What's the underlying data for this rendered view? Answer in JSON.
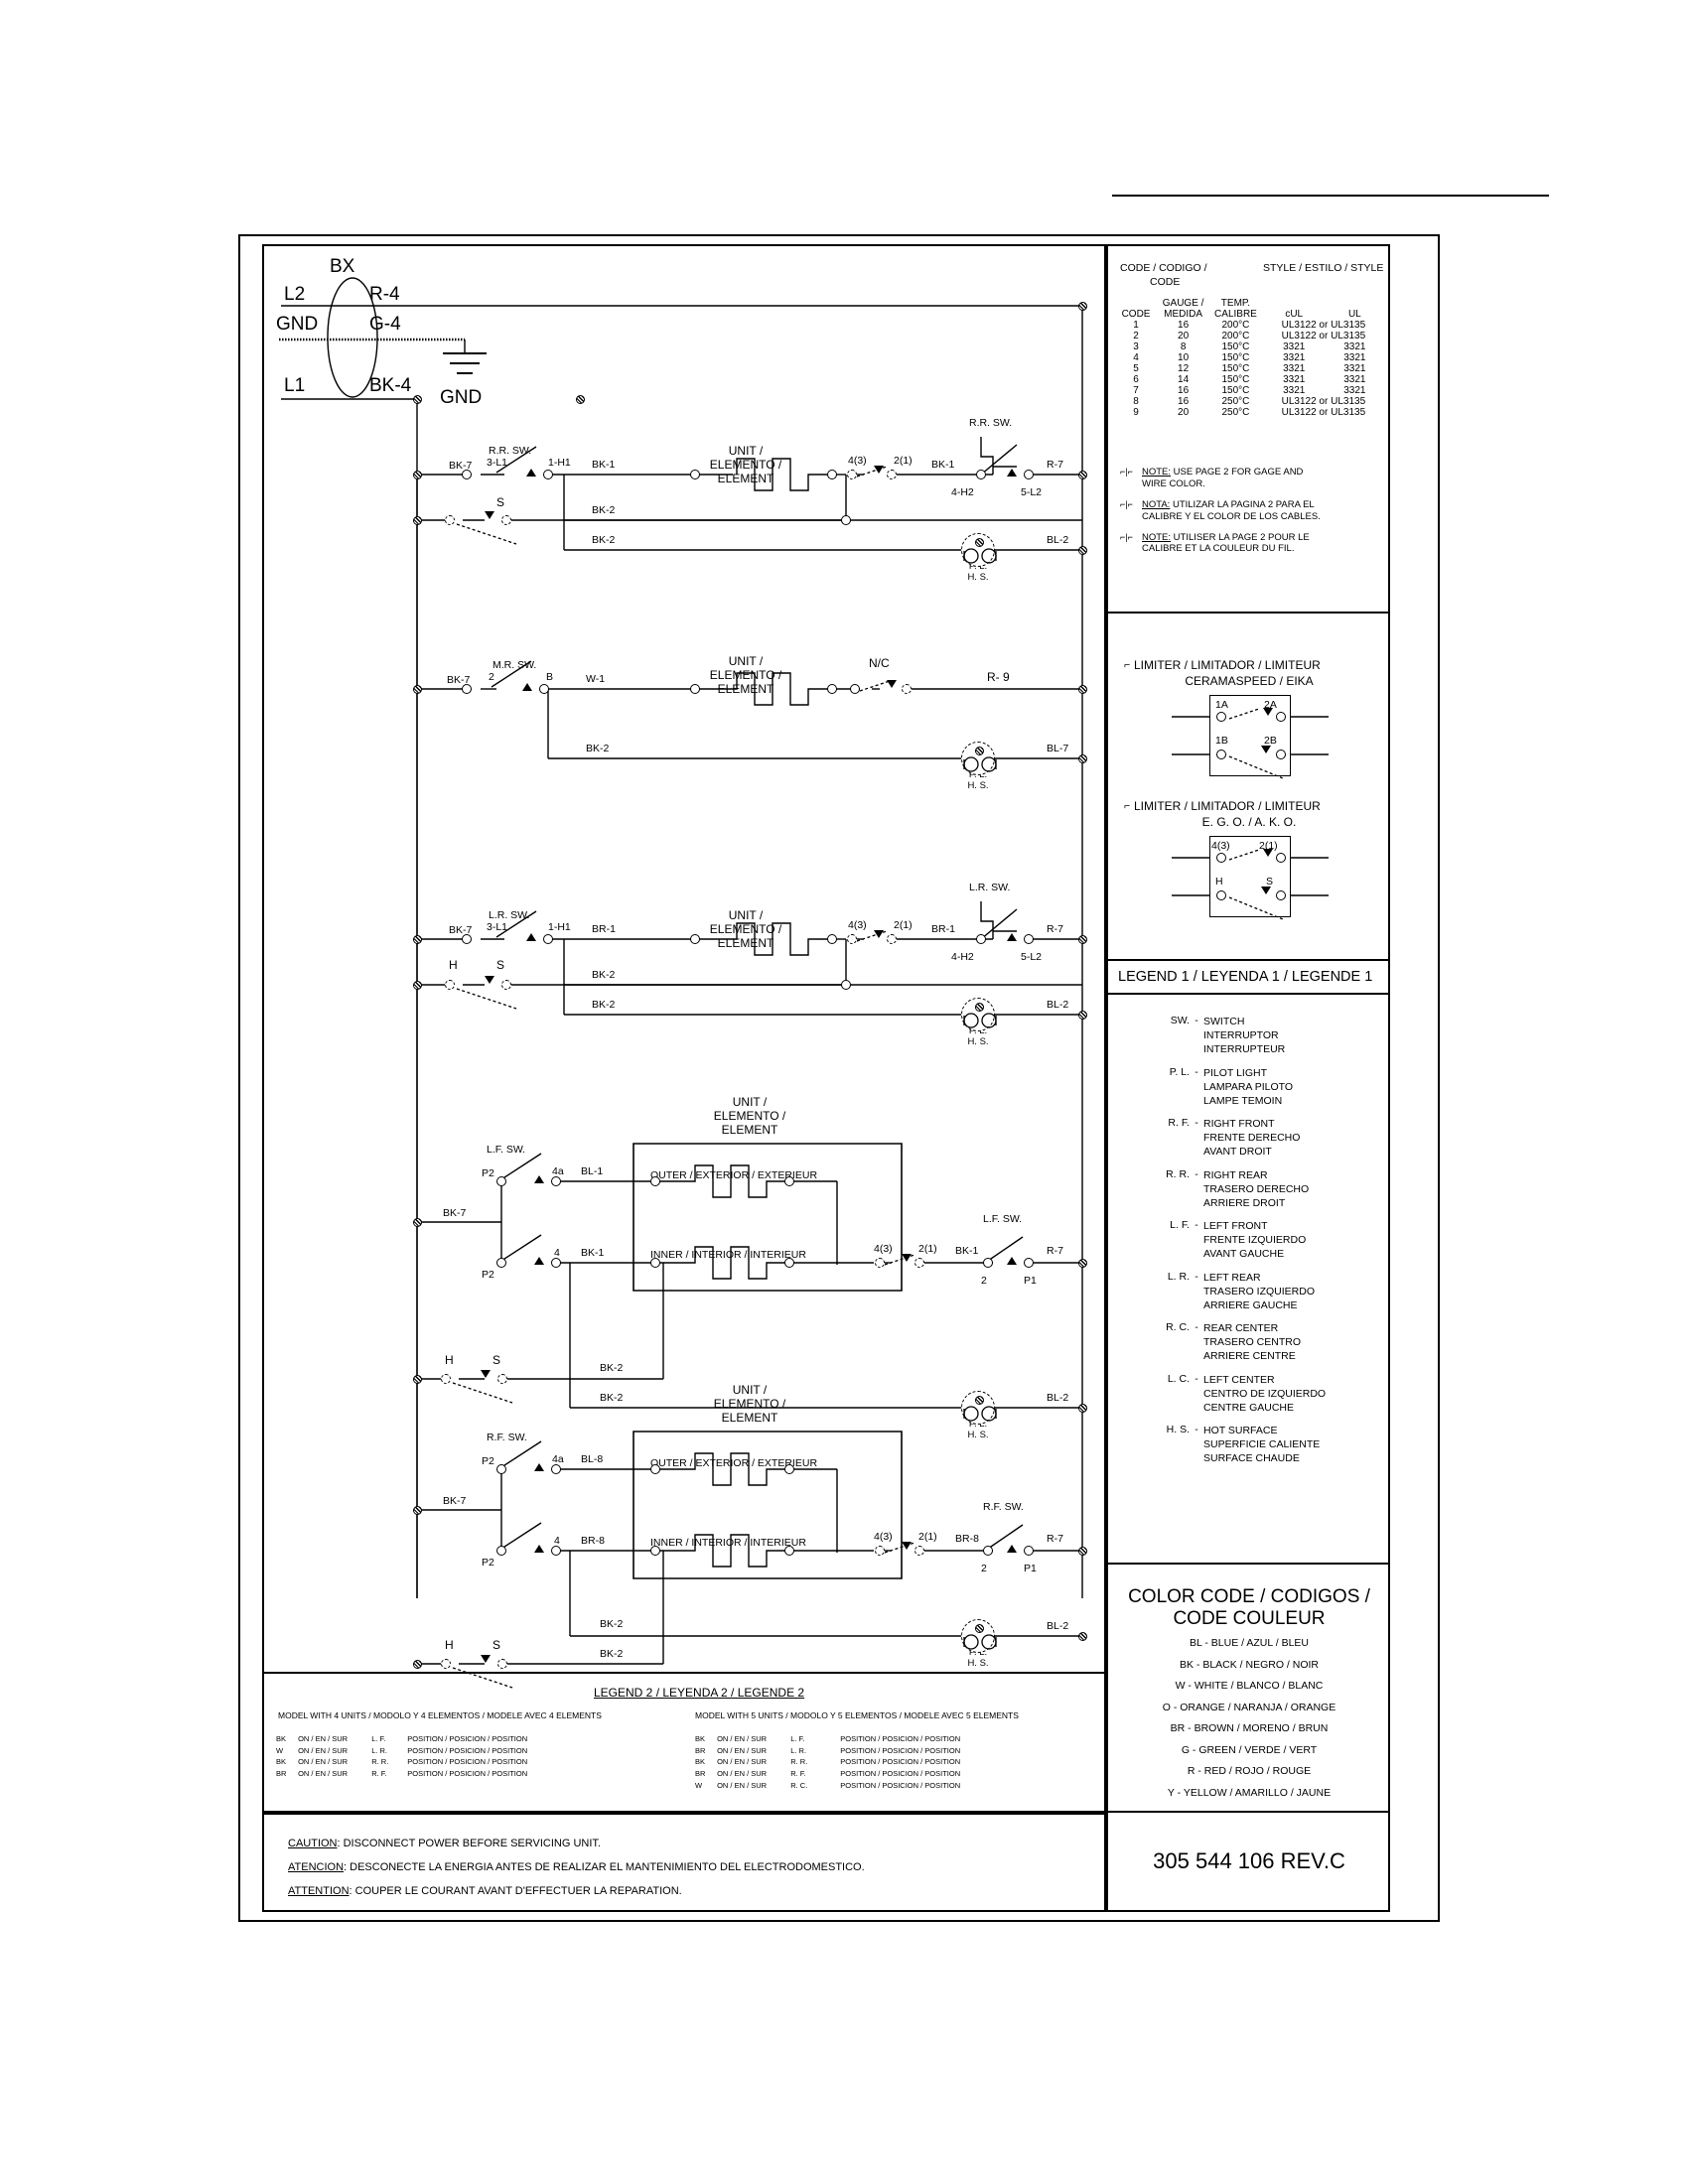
{
  "part_number": "305 544 106  REV.C",
  "power_input": {
    "bx": "BX",
    "l2": "L2",
    "l2_wire": "R-4",
    "gnd": "GND",
    "gnd_wire": "G-4",
    "gnd_symbol_label": "GND",
    "l1": "L1",
    "l1_wire": "BK-4"
  },
  "code_table": {
    "title_left": "CODE / CODIGO /",
    "title_left2": "CODE",
    "title_right": "STYLE / ESTILO / STYLE",
    "headers": [
      "CODE",
      "GAUGE /\nMEDIDA",
      "TEMP.\nCALIBRE",
      "cUL",
      "UL"
    ],
    "h_code": "CODE",
    "h_gauge1": "GAUGE /",
    "h_gauge2": "MEDIDA",
    "h_temp1": "TEMP.",
    "h_temp2": "CALIBRE",
    "h_cul": "cUL",
    "h_ul": "UL",
    "rows": [
      {
        "code": "1",
        "gauge": "16",
        "temp": "200°C",
        "cul": "UL3122 or UL3135",
        "ul": ""
      },
      {
        "code": "2",
        "gauge": "20",
        "temp": "200°C",
        "cul": "UL3122 or UL3135",
        "ul": ""
      },
      {
        "code": "3",
        "gauge": "8",
        "temp": "150°C",
        "cul": "3321",
        "ul": "3321"
      },
      {
        "code": "4",
        "gauge": "10",
        "temp": "150°C",
        "cul": "3321",
        "ul": "3321"
      },
      {
        "code": "5",
        "gauge": "12",
        "temp": "150°C",
        "cul": "3321",
        "ul": "3321"
      },
      {
        "code": "6",
        "gauge": "14",
        "temp": "150°C",
        "cul": "3321",
        "ul": "3321"
      },
      {
        "code": "7",
        "gauge": "16",
        "temp": "150°C",
        "cul": "3321",
        "ul": "3321"
      },
      {
        "code": "8",
        "gauge": "16",
        "temp": "250°C",
        "cul": "UL3122 or UL3135",
        "ul": ""
      },
      {
        "code": "9",
        "gauge": "20",
        "temp": "250°C",
        "cul": "UL3122 or UL3135",
        "ul": ""
      }
    ],
    "notes": [
      {
        "label": "NOTE:",
        "line1": "USE PAGE 2 FOR GAGE AND",
        "line2": "WIRE COLOR."
      },
      {
        "label": "NOTA:",
        "line1": "UTILIZAR LA PAGINA 2 PARA EL",
        "line2": "CALIBRE Y EL COLOR DE LOS CABLES."
      },
      {
        "label": "NOTE:",
        "line1": "UTILISER LA PAGE 2 POUR LE",
        "line2": "CALIBRE ET LA COULEUR DU FIL."
      }
    ]
  },
  "limiters": [
    {
      "title1": "LIMITER / LIMITADOR / LIMITEUR",
      "title2": "CERAMASPEED / EIKA",
      "tl": "1A",
      "tr": "2A",
      "bl": "1B",
      "br": "2B"
    },
    {
      "title1": "LIMITER / LIMITADOR / LIMITEUR",
      "title2": "E. G. O. / A. K. O.",
      "tl": "4(3)",
      "tr": "2(1)",
      "bl": "H",
      "br": "S"
    }
  ],
  "legend1": {
    "header": "LEGEND 1 / LEYENDA 1 / LEGENDE 1",
    "items": [
      {
        "abbr": "SW.",
        "en": "SWITCH",
        "es": "INTERRUPTOR",
        "fr": "INTERRUPTEUR"
      },
      {
        "abbr": "P. L.",
        "en": "PILOT LIGHT",
        "es": "LAMPARA PILOTO",
        "fr": "LAMPE TEMOIN"
      },
      {
        "abbr": "R. F.",
        "en": "RIGHT FRONT",
        "es": "FRENTE DERECHO",
        "fr": "AVANT DROIT"
      },
      {
        "abbr": "R. R.",
        "en": "RIGHT REAR",
        "es": "TRASERO DERECHO",
        "fr": "ARRIERE DROIT"
      },
      {
        "abbr": "L. F.",
        "en": "LEFT FRONT",
        "es": "FRENTE IZQUIERDO",
        "fr": "AVANT GAUCHE"
      },
      {
        "abbr": "L. R.",
        "en": "LEFT REAR",
        "es": "TRASERO IZQUIERDO",
        "fr": "ARRIERE GAUCHE"
      },
      {
        "abbr": "R. C.",
        "en": "REAR CENTER",
        "es": "TRASERO CENTRO",
        "fr": "ARRIERE CENTRE"
      },
      {
        "abbr": "L. C.",
        "en": "LEFT CENTER",
        "es": "CENTRO DE IZQUIERDO",
        "fr": "CENTRE GAUCHE"
      },
      {
        "abbr": "H. S.",
        "en": "HOT SURFACE",
        "es": "SUPERFICIE CALIENTE",
        "fr": "SURFACE CHAUDE"
      }
    ],
    "dash": "-"
  },
  "color_code": {
    "title1": "COLOR CODE / CODIGOS /",
    "title2": "CODE COULEUR",
    "items": [
      "BL - BLUE / AZUL / BLEU",
      "BK - BLACK / NEGRO / NOIR",
      "W  - WHITE / BLANCO / BLANC",
      "O  - ORANGE / NARANJA / ORANGE",
      "BR - BROWN / MORENO / BRUN",
      "G  - GREEN / VERDE / VERT",
      "R - RED / ROJO / ROUGE",
      "Y - YELLOW / AMARILLO / JAUNE"
    ]
  },
  "legend2": {
    "header": "LEGEND 2 / LEYENDA 2 / LEGENDE 2",
    "col4_title": "MODEL WITH 4 UNITS / MODOLO Y 4 ELEMENTOS / MODELE AVEC 4 ELEMENTS",
    "col5_title": "MODEL WITH 5 UNITS / MODOLO Y 5 ELEMENTOS / MODELE AVEC 5 ELEMENTS",
    "on_text": "ON / EN / SUR",
    "pos_text": "POSITION / POSICION / POSITION",
    "col4_rows": [
      {
        "color": "BK",
        "loc": "L. F."
      },
      {
        "color": "W",
        "loc": "L. R."
      },
      {
        "color": "BK",
        "loc": "R. R."
      },
      {
        "color": "BR",
        "loc": "R. F."
      }
    ],
    "col5_rows": [
      {
        "color": "BK",
        "loc": "L. F."
      },
      {
        "color": "BR",
        "loc": "L. R."
      },
      {
        "color": "BK",
        "loc": "R. R."
      },
      {
        "color": "BR",
        "loc": "R. F."
      },
      {
        "color": "W",
        "loc": "R. C."
      }
    ]
  },
  "caution": [
    {
      "label": "CAUTION",
      "text": ": DISCONNECT POWER BEFORE SERVICING UNIT."
    },
    {
      "label": "ATENCION",
      "text": ": DESCONECTE LA ENERGIA ANTES DE REALIZAR EL MANTENIMIENTO DEL ELECTRODOMESTICO."
    },
    {
      "label": "ATTENTION",
      "text": ": COUPER LE COURANT AVANT D'EFFECTUER LA REPARATION."
    }
  ],
  "unit_label": {
    "l1": "UNIT /",
    "l2": "ELEMENTO /",
    "l3": "ELEMENT"
  },
  "element_box": {
    "outer": "OUTER / EXTERIOR / EXTERIEUR",
    "inner": "INNER / INTERIOR / INTERIEUR"
  },
  "pilot": {
    "l1": "P. L.",
    "l2": "H. S."
  },
  "circuits": [
    {
      "name": "rr",
      "sw_label": "R.R. SW.",
      "sw_label2": "R.R. SW.",
      "in_wire": "BK-7",
      "sw_left_term": "3-L1",
      "sw_right_term": "1-H1",
      "elem_wire": "BK-1",
      "lim_left": "4(3)",
      "lim_right": "2(1)",
      "out_wire": "BK-1",
      "out_term_l": "4-H2",
      "out_term_r": "5-L2",
      "out_line": "R-7",
      "neutral_h": "",
      "neutral_s": "S",
      "bk2a": "BK-2",
      "bk2b": "BK-2",
      "lamp_wire": "BL-2"
    },
    {
      "name": "mr",
      "sw_label": "M.R. SW.",
      "in_wire": "BK-7",
      "sw_left_term": "2",
      "sw_right_term": "B",
      "elem_wire": "W-1",
      "nc": "N/C",
      "out_line": "R- 9",
      "bk2a": "BK-2",
      "lamp_wire": "BL-7"
    },
    {
      "name": "lr",
      "sw_label": "L.R. SW.",
      "sw_label2": "L.R. SW.",
      "in_wire": "BK-7",
      "sw_left_term": "3-L1",
      "sw_right_term": "1-H1",
      "elem_wire": "BR-1",
      "lim_left": "4(3)",
      "lim_right": "2(1)",
      "out_wire": "BR-1",
      "out_term_l": "4-H2",
      "out_term_r": "5-L2",
      "out_line": "R-7",
      "neutral_h": "H",
      "neutral_s": "S",
      "bk2a": "BK-2",
      "bk2b": "BK-2",
      "lamp_wire": "BL-2"
    },
    {
      "name": "lf",
      "sw_label": "L.F. SW.",
      "sw_label2": "L.F. SW.",
      "in_wire": "BK-7",
      "p2_top": "P2",
      "p2_bot": "P2",
      "term_4a": "4a",
      "outer_wire": "BL-1",
      "term_4": "4",
      "inner_wire": "BK-1",
      "lim_left": "4(3)",
      "lim_right": "2(1)",
      "out_wire": "BK-1",
      "out_term": "2",
      "out_p1": "P1",
      "out_line": "R-7",
      "neutral_h": "H",
      "neutral_s": "S",
      "bk2a": "BK-2",
      "bk2b": "BK-2",
      "lamp_wire": "BL-2"
    },
    {
      "name": "rf",
      "sw_label": "R.F. SW.",
      "sw_label2": "R.F. SW.",
      "in_wire": "BK-7",
      "p2_top": "P2",
      "p2_bot": "P2",
      "term_4a": "4a",
      "outer_wire": "BL-8",
      "term_4": "4",
      "inner_wire": "BR-8",
      "lim_left": "4(3)",
      "lim_right": "2(1)",
      "out_wire": "BR-8",
      "out_term": "2",
      "out_p1": "P1",
      "out_line": "R-7",
      "neutral_h": "H",
      "neutral_s": "S",
      "bk2a": "BK-2",
      "bk2b": "BK-2",
      "lamp_wire": "BL-2"
    }
  ]
}
